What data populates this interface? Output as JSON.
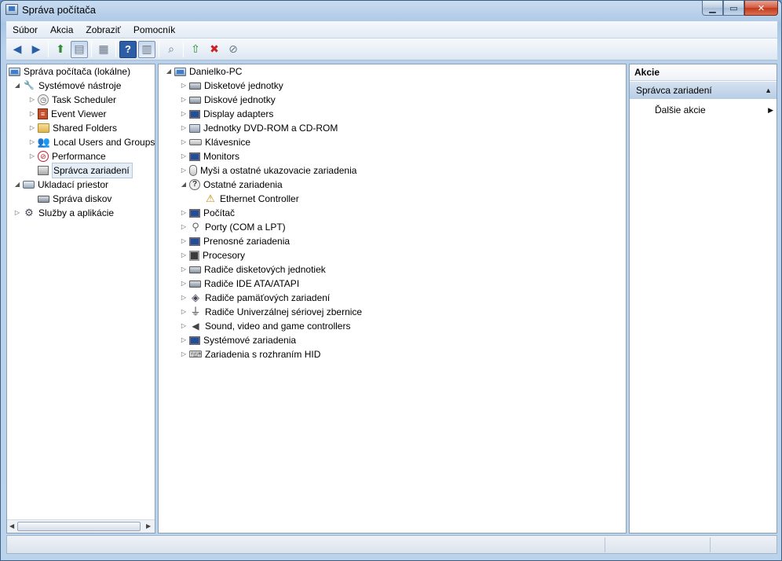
{
  "window": {
    "title": "Správa počítača"
  },
  "menu": [
    "Súbor",
    "Akcia",
    "Zobraziť",
    "Pomocník"
  ],
  "toolbar_icons": [
    "back-arrow-icon",
    "forward-arrow-icon",
    "up-folder-icon",
    "show-hide-tree-icon",
    "properties-icon",
    "help-icon",
    "show-hide-action-pane-icon",
    "scan-hardware-icon",
    "update-driver-icon",
    "uninstall-icon",
    "disable-icon"
  ],
  "left_tree": {
    "root": "Správa počítača (lokálne)",
    "system_tools": "Systémové nástroje",
    "task_scheduler": "Task Scheduler",
    "event_viewer": "Event Viewer",
    "shared_folders": "Shared Folders",
    "local_users": "Local Users and Groups",
    "performance": "Performance",
    "device_manager": "Správca zariadení",
    "storage": "Ukladací priestor",
    "disk_mgmt": "Správa diskov",
    "services": "Služby a aplikácie"
  },
  "devices": {
    "root": "Danielko-PC",
    "categories": [
      "Disketové jednotky",
      "Diskové jednotky",
      "Display adapters",
      "Jednotky DVD-ROM a CD-ROM",
      "Klávesnice",
      "Monitors",
      "Myši a ostatné ukazovacie zariadenia",
      "Ostatné zariadenia",
      "Ethernet Controller",
      "Počítač",
      "Porty (COM a LPT)",
      "Prenosné zariadenia",
      "Procesory",
      "Radiče disketových jednotiek",
      "Radiče IDE ATA/ATAPI",
      "Radiče pamäťových zariadení",
      "Radiče Univerzálnej sériovej zbernice",
      "Sound, video and game controllers",
      "Systémové zariadenia",
      "Zariadenia s rozhraním HID"
    ]
  },
  "actions": {
    "header": "Akcie",
    "section": "Správca zariadení",
    "more": "Ďalšie akcie"
  }
}
